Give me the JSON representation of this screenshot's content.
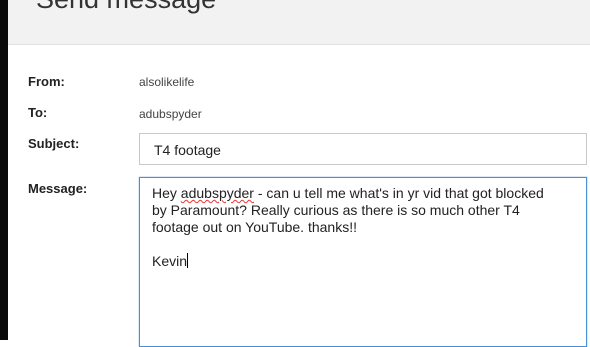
{
  "header": {
    "title": "Send message"
  },
  "form": {
    "from_label": "From:",
    "from_value": "alsolikelife",
    "to_label": "To:",
    "to_value": "adubspyder",
    "subject_label": "Subject:",
    "subject_value": "T4 footage",
    "message_label": "Message:",
    "message_line1_pre": "Hey ",
    "message_line1_misspelled": "adubspyder",
    "message_line1_post": " - can u tell me what's in yr vid that got blocked",
    "message_line2": "by Paramount? Really curious as there is so much other T4",
    "message_line3": "footage out on YouTube. thanks!!",
    "message_signature": "Kevin"
  }
}
